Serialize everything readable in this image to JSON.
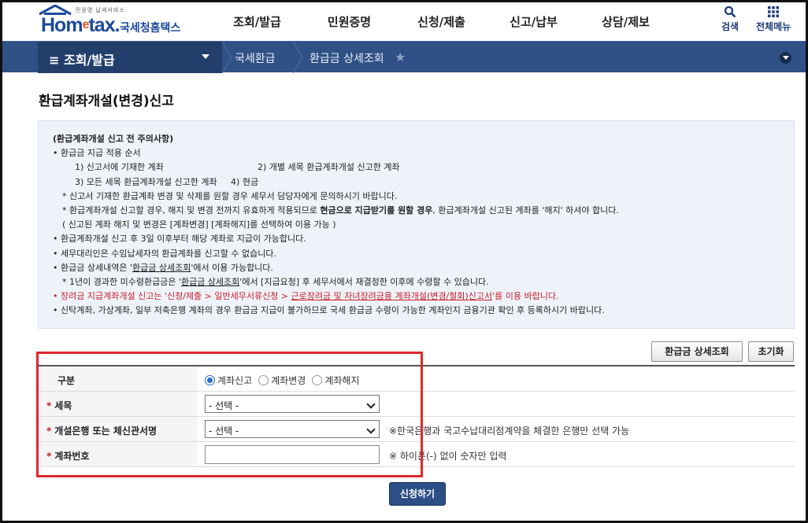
{
  "header": {
    "logo_small": "민원명 납세서비스",
    "logo_main_a": "Hom",
    "logo_main_e": "e",
    "logo_main_b": "tax.",
    "logo_kor": "국세청홈택스",
    "gnb": [
      "조회/발급",
      "민원증명",
      "신청/제출",
      "신고/납부",
      "상담/제보"
    ],
    "search_label": "검색",
    "allmenu_label": "전체메뉴"
  },
  "navbar": {
    "menu_label": "조회/발급",
    "crumbs": [
      "국세환급",
      "환급금 상세조회"
    ]
  },
  "page_title": "환급계좌개설(변경)신고",
  "notice": {
    "heading": "(환급계좌개설 신고 전 주의사항)",
    "l1": "환급금 지급 적용 순서",
    "l2a": "1) 신고서에 기재한 계좌",
    "l2b": "2) 개별 세목 환급계좌개설 신고한 계좌",
    "l3": "3) 모든 세목 환급계좌개설 신고한 계좌     4) 현금",
    "l4": "* 신고서 기재한 환급계좌 변경 및 삭제를 원할 경우 세무서 담당자에게 문의하시기 바랍니다.",
    "l5a": "* 환급계좌개설 신고할 경우, 해지 및 변경 전까지 유효하게 적용되므로 ",
    "l5b": "현금으로 지급받기를 원할 경우",
    "l5c": ", 환급계좌개설 신고된 계좌를 '해지' 하셔야 합니다.",
    "l6": "( 신고된 계좌 해지 및 변경은 [계좌변경] [계좌해지]를 선택하여 이용 가능 )",
    "l7": "환급계좌개설 신고 후 3일 이후부터 해당 계좌로 지급이 가능합니다.",
    "l8": "세무대리인은 수임납세자의 환급계좌를 신고할 수 없습니다.",
    "l9a": "환급금 상세내역은 '",
    "l9b": "환급금 상세조회",
    "l9c": "'에서 이용 가능합니다.",
    "l10a": "* 1년이 경과한 미수령환급금은 '",
    "l10b": "환급금 상세조회",
    "l10c": "'에서 [지급요청] 후 세무서에서 재결정한 이후에 수령할 수 있습니다.",
    "l11a": "장려금 지급계좌개설 신고는 '신청/제출 > 일반세무서류신청 > ",
    "l11b": "근로장려금 및 자녀장려금용 계좌개설(변경/철회)신고서",
    "l11c": "'를 이용 바랍니다.",
    "l12": "신탁계좌, 가상계좌, 일부 저축은행 계좌의 경우 환급금 지급이 불가하므로 국세 환급금 수령이 가능한 계좌인지 금융기관 확인 후 등록하시기 바랍니다."
  },
  "buttons": {
    "detail": "환급금 상세조회",
    "reset": "초기화",
    "submit": "신청하기"
  },
  "form": {
    "type_label": "구분",
    "type_options": [
      "계좌신고",
      "계좌변경",
      "계좌해지"
    ],
    "type_selected": "계좌신고",
    "tax_label": "세목",
    "tax_value": "- 선택 -",
    "bank_label": "개설은행 또는 체신관서명",
    "bank_value": "- 선택 -",
    "bank_hint": "※한국은행과 국고수납대리점계약을 체결한 은행만 선택 가능",
    "account_label": "계좌번호",
    "account_value": "",
    "account_hint": "※ 하이픈(-) 없이 숫자만 입력"
  },
  "colors": {
    "brand_blue": "#1c4a9c",
    "navbar": "#2f5185",
    "navbar_dark": "#223f6b",
    "required": "#c8202c",
    "highlight_box": "#e0272e",
    "submit_button": "#2c4f86"
  }
}
